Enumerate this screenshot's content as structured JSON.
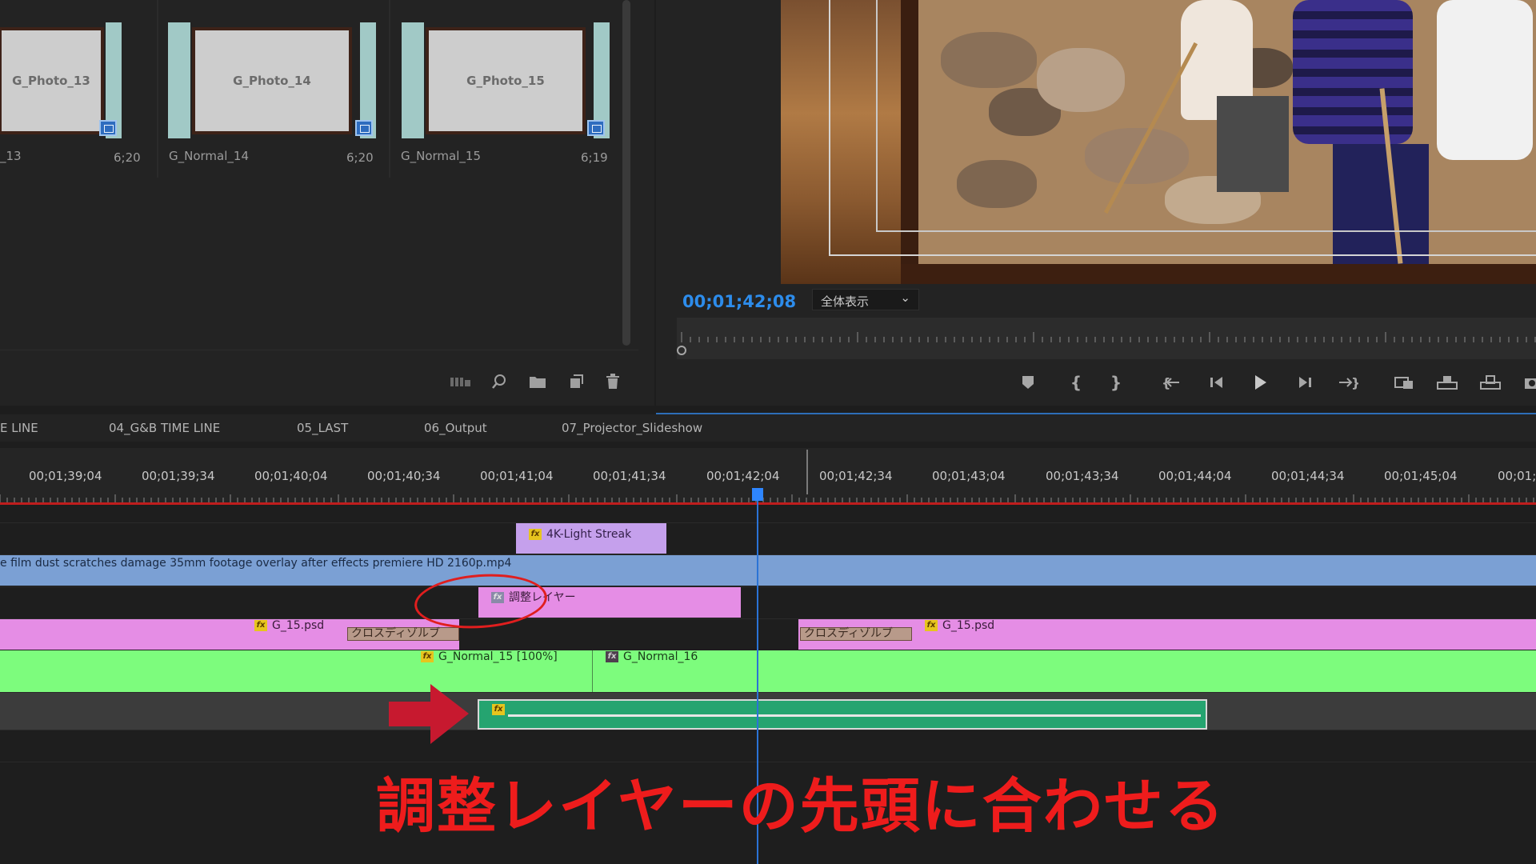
{
  "project": {
    "items": [
      {
        "thumb_label": "G_Photo_13",
        "name": "_13",
        "duration": "6;20"
      },
      {
        "thumb_label": "G_Photo_14",
        "name": "G_Normal_14",
        "duration": "6;20"
      },
      {
        "thumb_label": "G_Photo_15",
        "name": "G_Normal_15",
        "duration": "6;19"
      }
    ],
    "tools": [
      "freeform-view-icon",
      "find-icon",
      "new-bin-icon",
      "new-item-icon",
      "clear-icon"
    ]
  },
  "monitor": {
    "timecode": "00;01;42;08",
    "zoom_value": "全体表示",
    "buttons": [
      "add-marker",
      "mark-in",
      "mark-out",
      "go-to-in",
      "step-back",
      "play",
      "step-forward",
      "go-to-out",
      "insert",
      "lift",
      "extract",
      "export-frame"
    ]
  },
  "timeline": {
    "tabs": [
      "E LINE",
      "04_G&B TIME LINE",
      "05_LAST",
      "06_Output",
      "07_Projector_Slideshow"
    ],
    "timecodes": [
      "00;01;39;04",
      "00;01;39;34",
      "00;01;40;04",
      "00;01;40;34",
      "00;01;41;04",
      "00;01;41;34",
      "00;01;42;04",
      "00;01;42;34",
      "00;01;43;04",
      "00;01;43;34",
      "00;01;44;04",
      "00;01;44;34",
      "00;01;45;04",
      "00;01;"
    ],
    "clips": {
      "light_streak": "4K-Light Streak",
      "film_overlay": "e film dust scratches damage 35mm footage overlay after effects premiere HD 2160p.mp4",
      "adjustment_layer": "調整レイヤー",
      "g15_left": "G_15.psd",
      "g15_right": "G_15.psd",
      "cross_dissolve_left": "クロスディゾルブ",
      "cross_dissolve_right": "クロスディゾルブ",
      "g_normal_15": "G_Normal_15 [100%]",
      "g_normal_16": "G_Normal_16"
    },
    "colors": {
      "lavender": "#c5a0ec",
      "blue": "#7ba0d4",
      "pink": "#e58de5",
      "green": "#7dfc7d",
      "teal": "#25a470"
    }
  },
  "annotation": {
    "text": "調整レイヤーの先頭に合わせる",
    "color": "#ee1c1c"
  }
}
